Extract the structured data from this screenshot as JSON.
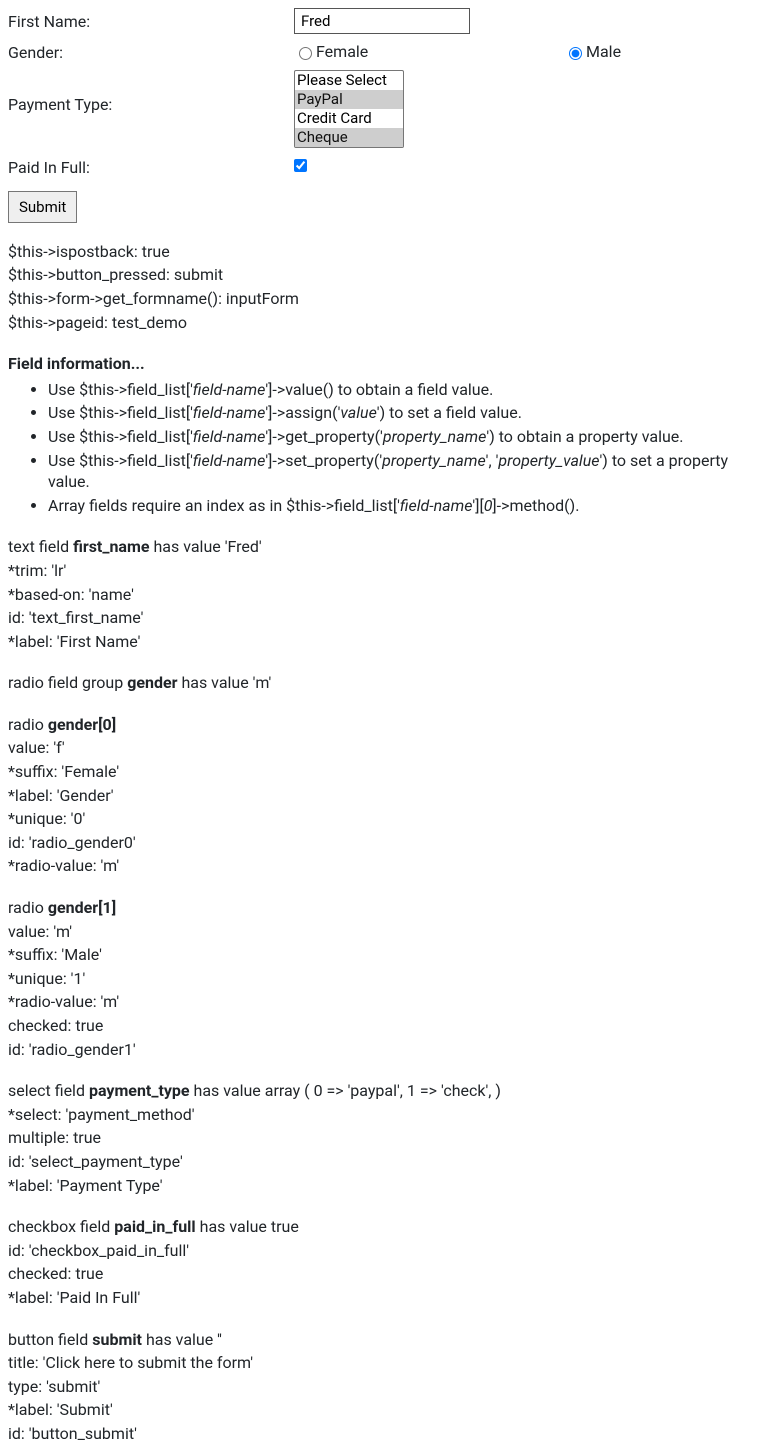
{
  "form": {
    "first_name": {
      "label": "First Name:",
      "value": "Fred"
    },
    "gender": {
      "label": "Gender:",
      "options": [
        {
          "label": "Female",
          "checked": false
        },
        {
          "label": "Male",
          "checked": true
        }
      ]
    },
    "payment_type": {
      "label": "Payment Type:",
      "options": [
        {
          "label": "Please Select",
          "selected": false
        },
        {
          "label": "PayPal",
          "selected": true
        },
        {
          "label": "Credit Card",
          "selected": false
        },
        {
          "label": "Cheque",
          "selected": true
        }
      ]
    },
    "paid_in_full": {
      "label": "Paid In Full:",
      "checked": true
    },
    "submit": {
      "label": "Submit"
    }
  },
  "debug": {
    "l1": "$this->ispostback: true",
    "l2": "$this->button_pressed: submit",
    "l3": "$this->form->get_formname(): inputForm",
    "l4": "$this->pageid: test_demo"
  },
  "field_info": {
    "heading": "Field information...",
    "b1a": "Use $this->field_list['",
    "b1b": "field-name",
    "b1c": "']->value() to obtain a field value.",
    "b2a": "Use $this->field_list['",
    "b2b": "field-name",
    "b2c": "']->assign('",
    "b2d": "value",
    "b2e": "') to set a field value.",
    "b3a": "Use $this->field_list['",
    "b3b": "field-name",
    "b3c": "']->get_property('",
    "b3d": "property_name",
    "b3e": "') to obtain a property value.",
    "b4a": "Use $this->field_list['",
    "b4b": "field-name",
    "b4c": "']->set_property('",
    "b4d": "property_name",
    "b4e": "', '",
    "b4f": "property_value",
    "b4g": "') to set a property value.",
    "b5a": "Array fields require an index as in $this->field_list['",
    "b5b": "field-name",
    "b5c": "'][",
    "b5d": "0",
    "b5e": "]->method()."
  },
  "fn": {
    "head_a": "text field ",
    "head_b": "first_name",
    "head_c": " has value 'Fred'",
    "p1": "*trim: 'lr'",
    "p2": "*based-on: 'name'",
    "p3": "id: 'text_first_name'",
    "p4": "*label: 'First Name'"
  },
  "gg": {
    "head_a": "radio field group ",
    "head_b": "gender",
    "head_c": " has value 'm'"
  },
  "g0": {
    "head_a": "radio ",
    "head_b": "gender[0]",
    "p1": "value: 'f'",
    "p2": "*suffix: 'Female'",
    "p3": "*label: 'Gender'",
    "p4": "*unique: '0'",
    "p5": "id: 'radio_gender0'",
    "p6": "*radio-value: 'm'"
  },
  "g1": {
    "head_a": "radio ",
    "head_b": "gender[1]",
    "p1": "value: 'm'",
    "p2": "*suffix: 'Male'",
    "p3": "*unique: '1'",
    "p4": "*radio-value: 'm'",
    "p5": "checked: true",
    "p6": "id: 'radio_gender1'"
  },
  "pt": {
    "head_a": "select field ",
    "head_b": "payment_type",
    "head_c": " has value array ( 0 => 'paypal', 1 => 'check', )",
    "p1": "*select: 'payment_method'",
    "p2": "multiple: true",
    "p3": "id: 'select_payment_type'",
    "p4": "*label: 'Payment Type'"
  },
  "pf": {
    "head_a": "checkbox field ",
    "head_b": "paid_in_full",
    "head_c": " has value true",
    "p1": "id: 'checkbox_paid_in_full'",
    "p2": "checked: true",
    "p3": "*label: 'Paid In Full'"
  },
  "sb": {
    "head_a": "button field ",
    "head_b": "submit",
    "head_c": " has value ''",
    "p1": "title: 'Click here to submit the form'",
    "p2": "type: 'submit'",
    "p3": "*label: 'Submit'",
    "p4": "id: 'button_submit'"
  }
}
